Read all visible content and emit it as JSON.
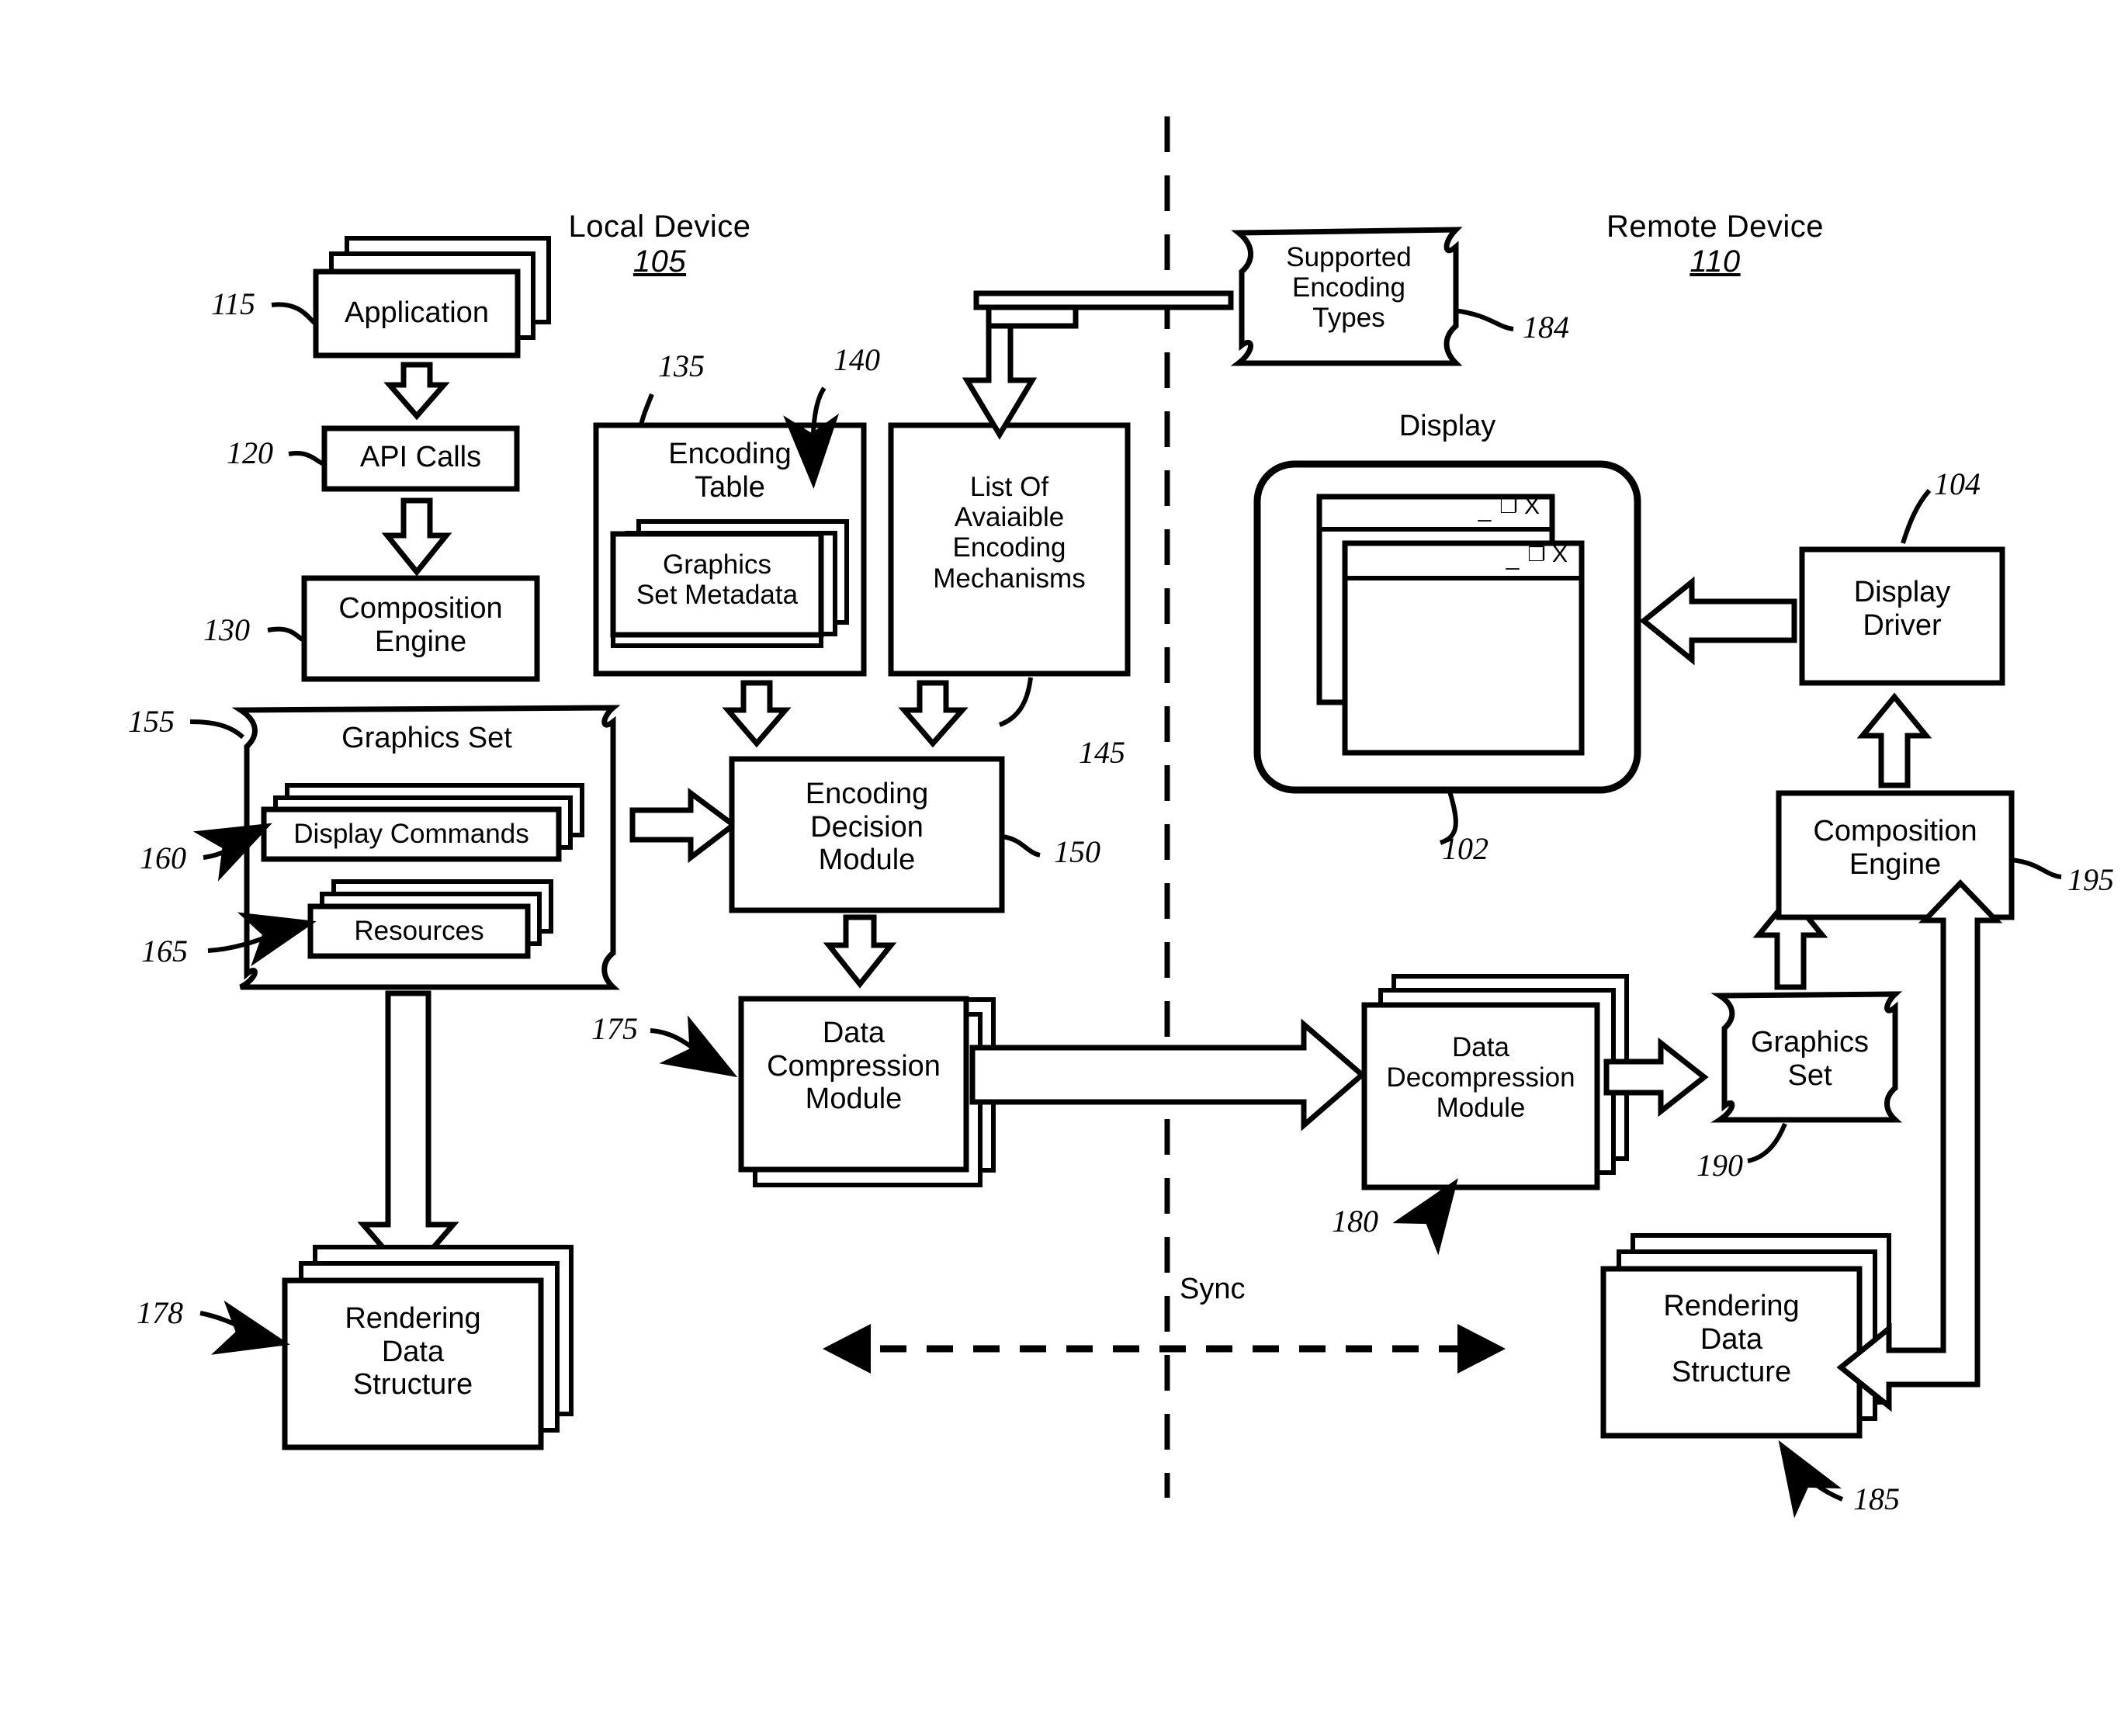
{
  "figure": {
    "title_local": "Local Device",
    "title_local_num": "105",
    "title_remote": "Remote Device",
    "title_remote_num": "110",
    "sync_label": "Sync",
    "display_label": "Display"
  },
  "local": {
    "application": "Application",
    "application_ref": "115",
    "api_calls": "API Calls",
    "api_calls_ref": "120",
    "composition_engine": "Composition\nEngine",
    "composition_engine_ref": "130",
    "encoding_table": "Encoding\nTable",
    "encoding_table_ref": "135",
    "graphics_set_metadata": "Graphics\nSet Metadata",
    "graphics_set_metadata_ref": "140",
    "list_of_available": "List Of\nAvaiaible\nEncoding\nMechanisms",
    "list_of_available_ref": "145",
    "graphics_set": "Graphics Set",
    "graphics_set_ref": "155",
    "display_commands": "Display Commands",
    "display_commands_ref": "160",
    "resources": "Resources",
    "resources_ref": "165",
    "encoding_decision_module": "Encoding\nDecision\nModule",
    "encoding_decision_module_ref": "150",
    "data_compression_module": "Data\nCompression\nModule",
    "data_compression_module_ref": "175",
    "rendering_data_structure": "Rendering\nData\nStructure",
    "rendering_data_structure_ref": "178"
  },
  "remote": {
    "supported_encoding_types": "Supported\nEncoding\nTypes",
    "supported_encoding_types_ref": "184",
    "display_stack_ref": "102",
    "display_driver": "Display\nDriver",
    "display_driver_ref": "104",
    "composition_engine": "Composition\nEngine",
    "composition_engine_ref": "195",
    "data_decompression_module": "Data\nDecompression\nModule",
    "data_decompression_module_ref": "180",
    "graphics_set": "Graphics\nSet",
    "graphics_set_ref": "190",
    "rendering_data_structure": "Rendering\nData\nStructure",
    "rendering_data_structure_ref": "185"
  },
  "window_icons": {
    "minimize": "_",
    "maximize": "❐",
    "close": "X"
  },
  "colors": {
    "stroke": "#000000",
    "fill": "#ffffff"
  }
}
